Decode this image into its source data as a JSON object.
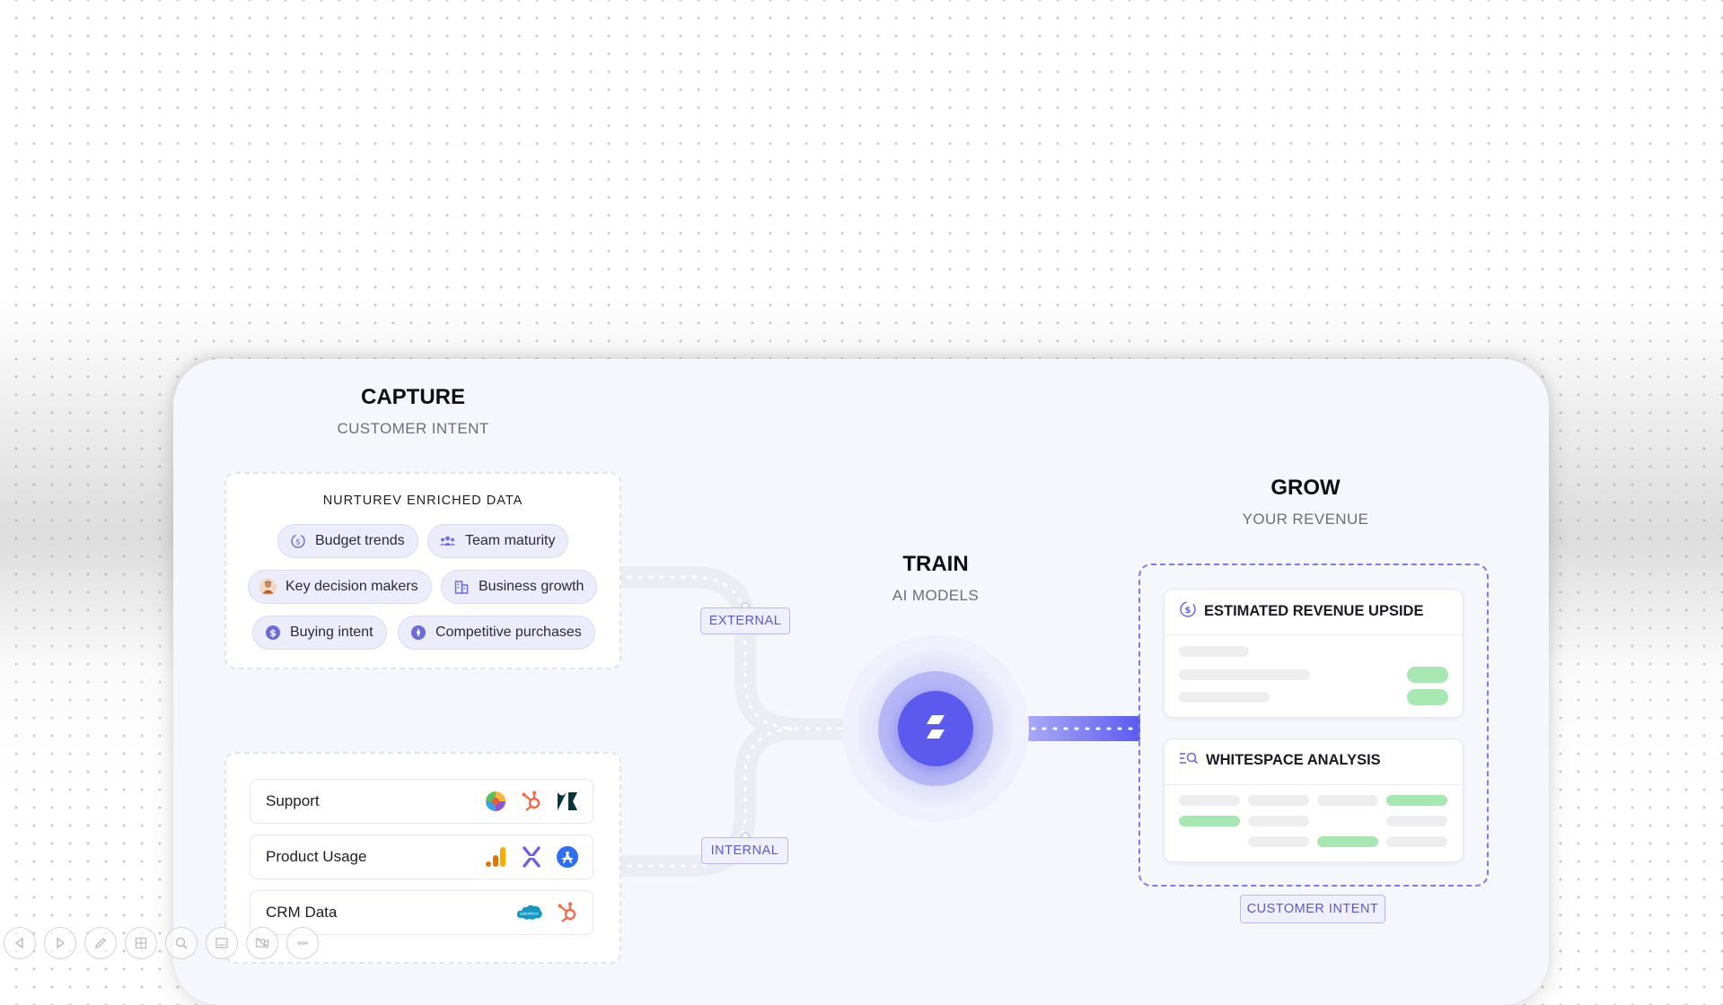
{
  "capture": {
    "title": "CAPTURE",
    "subtitle": "CUSTOMER INTENT",
    "enriched_title": "NURTUREV ENRICHED DATA",
    "chips": [
      {
        "label": "Budget trends",
        "icon": "dollar-clock-icon"
      },
      {
        "label": "Team maturity",
        "icon": "team-icon"
      },
      {
        "label": "Key decision makers",
        "icon": "person-avatar-icon"
      },
      {
        "label": "Business growth",
        "icon": "building-icon"
      },
      {
        "label": "Buying intent",
        "icon": "dollar-icon"
      },
      {
        "label": "Competitive purchases",
        "icon": "compass-icon"
      }
    ],
    "sources": [
      {
        "label": "Support",
        "logos": [
          "freshdesk-logo-icon",
          "hubspot-logo-icon",
          "zendesk-logo-icon"
        ]
      },
      {
        "label": "Product Usage",
        "logos": [
          "google-analytics-logo-icon",
          "mixpanel-logo-icon",
          "app-store-logo-icon"
        ]
      },
      {
        "label": "CRM Data",
        "logos": [
          "salesforce-logo-icon",
          "hubspot-logo-icon"
        ]
      }
    ]
  },
  "connectors": {
    "external": "EXTERNAL",
    "internal": "INTERNAL"
  },
  "train": {
    "title": "TRAIN",
    "subtitle": "AI MODELS"
  },
  "grow": {
    "title": "GROW",
    "subtitle": "YOUR REVENUE",
    "card1_title": "ESTIMATED REVENUE UPSIDE",
    "card2_title": "WHITESPACE ANALYSIS",
    "footer_tag": "CUSTOMER INTENT"
  },
  "colors": {
    "accent": "#5b5bf0",
    "panel_bg": "#f6f6fd",
    "chip_bg": "#ececfb",
    "tag_text": "#5a5ad6",
    "green_bar": "#a6e7b2",
    "grey_bar": "#eeeeee"
  },
  "toolbar": [
    "prev-icon",
    "next-icon",
    "pen-icon",
    "grid-icon",
    "zoom-icon",
    "subtitles-icon",
    "video-off-icon",
    "more-icon"
  ]
}
